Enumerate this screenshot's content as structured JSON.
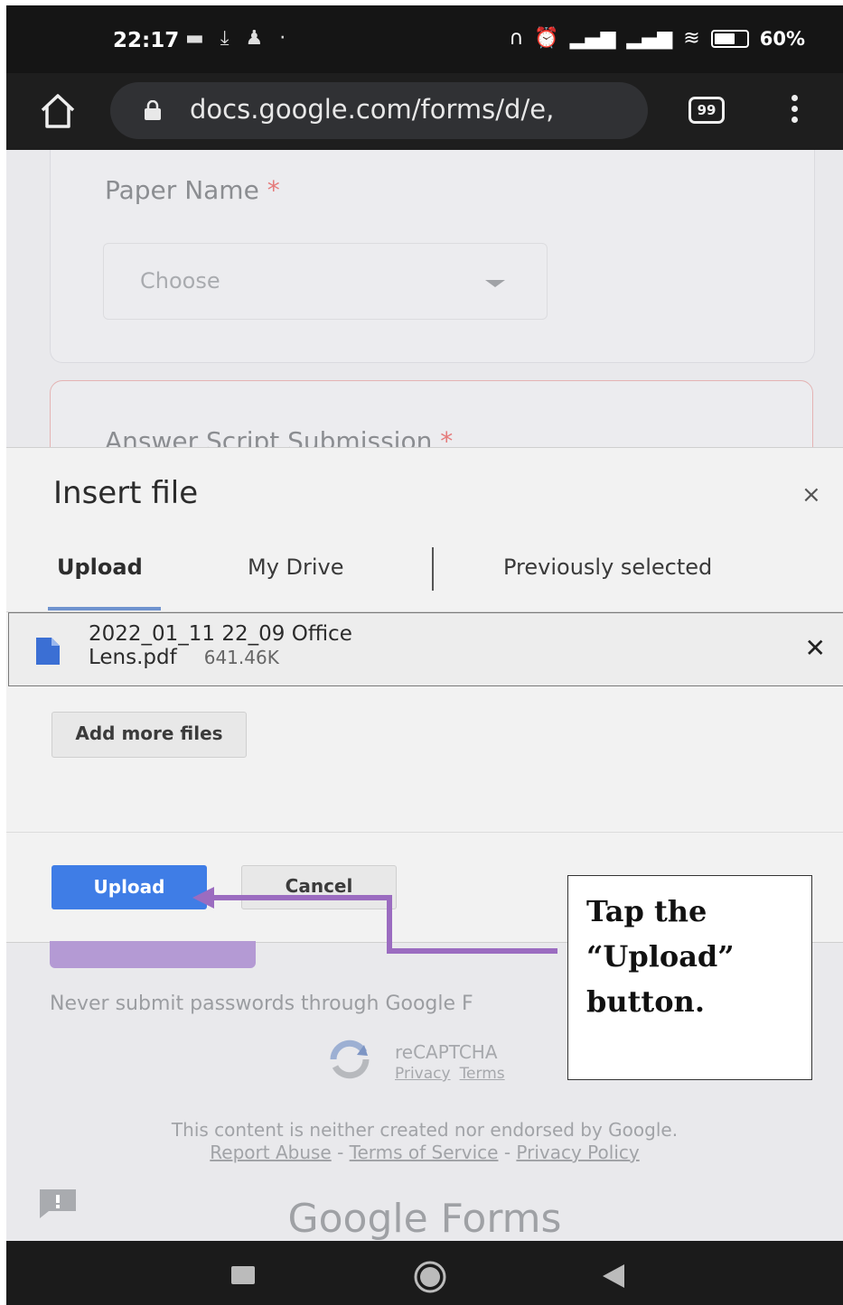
{
  "status_bar": {
    "time": "22:17",
    "battery_pct": "60%"
  },
  "browser": {
    "url": "docs.google.com/forms/d/e,",
    "tab_count": "99"
  },
  "form": {
    "q1_title": "Paper Name",
    "q1_required": "*",
    "q1_placeholder": "Choose",
    "q2_title": "Answer Script Submission",
    "q2_required": "*"
  },
  "dialog": {
    "title": "Insert file",
    "close_symbol": "×",
    "tabs": [
      {
        "label": "Upload"
      },
      {
        "label": "My Drive"
      },
      {
        "label": "Previously selected"
      }
    ],
    "file": {
      "name_line1": "2022_01_11 22_09 Office",
      "name_line2": "Lens.pdf",
      "size": "641.46K",
      "remove_symbol": "✕"
    },
    "add_more_label": "Add more files",
    "upload_label": "Upload",
    "cancel_label": "Cancel"
  },
  "footer": {
    "never_submit": "Never submit passwords through Google F",
    "recaptcha": "reCAPTCHA",
    "recaptcha_privacy": "Privacy",
    "recaptcha_terms": "Terms",
    "disclaimer": "This content is neither created nor endorsed by Google.",
    "report_abuse": "Report Abuse",
    "sep": " - ",
    "terms_of_service": "Terms of Service",
    "privacy_policy": "Privacy Policy",
    "brand": "Google Forms"
  },
  "callout": {
    "line1": "Tap the",
    "line2": "“Upload”",
    "line3": "button.",
    "arrow_color": "#9b6cc0"
  }
}
